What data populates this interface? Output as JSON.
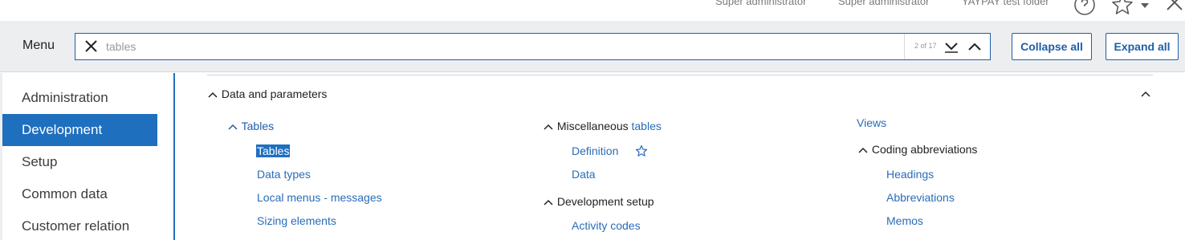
{
  "topbar": {
    "user1": "Super administrator",
    "user2": "Super administrator",
    "folder": "YAYPAY test folder"
  },
  "menubar": {
    "title": "Menu",
    "search": {
      "value": "tables",
      "placeholder": "tables"
    },
    "match_count": "2 of 17",
    "collapse_all": "Collapse all",
    "expand_all": "Expand all"
  },
  "sidebar": {
    "items": [
      {
        "label": "Administration",
        "active": false
      },
      {
        "label": "Development",
        "active": true
      },
      {
        "label": "Setup",
        "active": false
      },
      {
        "label": "Common data",
        "active": false
      },
      {
        "label": "Customer relation",
        "active": false
      }
    ]
  },
  "content": {
    "section_title": "Data and parameters",
    "col1": {
      "group": "Tables",
      "items": [
        "Tables",
        "Data types",
        "Local menus - messages",
        "Sizing elements"
      ]
    },
    "col2": {
      "group_prefix": "Miscellaneous ",
      "group_match": "tables",
      "items": [
        "Definition",
        "Data"
      ],
      "group2": "Development setup",
      "group2_items": [
        "Activity codes"
      ]
    },
    "col3": {
      "top_link": "Views",
      "group": "Coding abbreviations",
      "items": [
        "Headings",
        "Abbreviations",
        "Memos"
      ]
    }
  },
  "icons": {
    "help": "help-circle-icon",
    "favorite": "star-outline-icon",
    "dropdown": "caret-down-icon",
    "close": "close-icon",
    "clear": "close-icon",
    "next": "chevron-down-icon",
    "prev": "chevron-up-icon",
    "collapse": "chevron-up-icon",
    "expand": "chevron-up-icon"
  },
  "colors": {
    "accent": "#1f6fbf",
    "link": "#2a6cb8",
    "menubar_bg": "#eceef0"
  }
}
